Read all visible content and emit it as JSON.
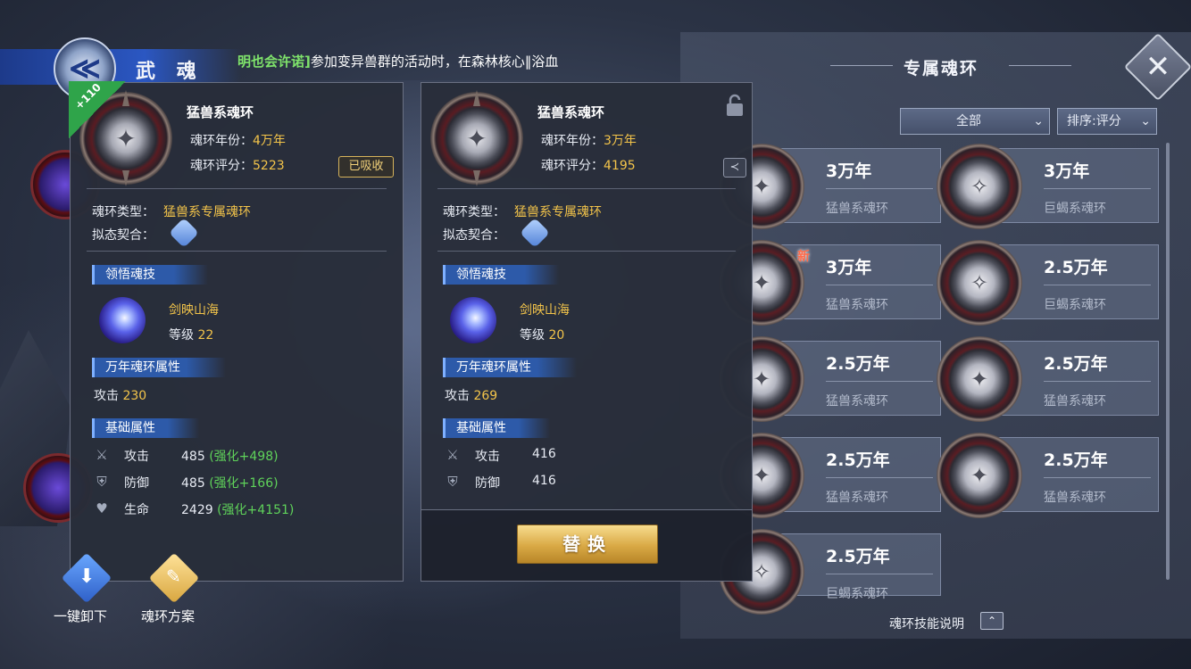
{
  "header": {
    "title": "武 魂",
    "emblem_glyph": "≪",
    "ticker_highlight": "明也会许诺]",
    "ticker_text": "参加变异兽群的活动时，在森林核心‖浴血"
  },
  "left_panel": {
    "level_badge": "+110",
    "name": "猛兽系魂环",
    "year_label": "魂环年份：",
    "year_value": "4万年",
    "score_label": "魂环评分：",
    "score_value": "5223",
    "absorbed_label": "已吸收",
    "type_label": "魂环类型：",
    "type_value": "猛兽系专属魂环",
    "mimic_label": "拟态契合：",
    "skill_section": "领悟魂技",
    "skill_name": "剑映山海",
    "skill_level_label": "等级",
    "skill_level": "22",
    "tenk_section": "万年魂环属性",
    "tenk_attr": "攻击",
    "tenk_value": "230",
    "base_section": "基础属性",
    "stats": [
      {
        "icon": "sword-icon",
        "label": "攻击",
        "value": "485",
        "bonus": "(强化+498)"
      },
      {
        "icon": "shield-icon",
        "label": "防御",
        "value": "485",
        "bonus": "(强化+166)"
      },
      {
        "icon": "heart-icon",
        "label": "生命",
        "value": "2429",
        "bonus": "(强化+4151)"
      }
    ]
  },
  "right_popup": {
    "name": "猛兽系魂环",
    "year_label": "魂环年份：",
    "year_value": "3万年",
    "score_label": "魂环评分：",
    "score_value": "4195",
    "type_label": "魂环类型：",
    "type_value": "猛兽系专属魂环",
    "mimic_label": "拟态契合：",
    "skill_section": "领悟魂技",
    "skill_name": "剑映山海",
    "skill_level_label": "等级",
    "skill_level": "20",
    "tenk_section": "万年魂环属性",
    "tenk_attr": "攻击",
    "tenk_value": "269",
    "base_section": "基础属性",
    "stats": [
      {
        "icon": "sword-icon",
        "label": "攻击",
        "value": "416"
      },
      {
        "icon": "shield-icon",
        "label": "防御",
        "value": "416"
      }
    ],
    "replace_label": "替换"
  },
  "bottom_left": {
    "unload_label": "一键卸下",
    "plan_label": "魂环方案"
  },
  "exclusive": {
    "title": "专属魂环",
    "filter_value": "全部",
    "sort_value": "排序:评分",
    "cards": [
      {
        "year": "3万年",
        "type": "猛兽系魂环",
        "new": ""
      },
      {
        "year": "3万年",
        "type": "巨蝎系魂环",
        "new": ""
      },
      {
        "year": "3万年",
        "type": "猛兽系魂环",
        "new": "新"
      },
      {
        "year": "2.5万年",
        "type": "巨蝎系魂环",
        "new": ""
      },
      {
        "year": "2.5万年",
        "type": "猛兽系魂环",
        "new": ""
      },
      {
        "year": "2.5万年",
        "type": "猛兽系魂环",
        "new": ""
      },
      {
        "year": "2.5万年",
        "type": "猛兽系魂环",
        "new": ""
      },
      {
        "year": "2.5万年",
        "type": "猛兽系魂环",
        "new": ""
      },
      {
        "year": "2.5万年",
        "type": "巨蝎系魂环",
        "new": ""
      }
    ],
    "help_label": "魂环技能说明"
  },
  "colors": {
    "gold": "#f3c44a",
    "green": "#5fd35a",
    "accent_blue": "#2d5aa9",
    "button_gold": "#d9a945"
  }
}
